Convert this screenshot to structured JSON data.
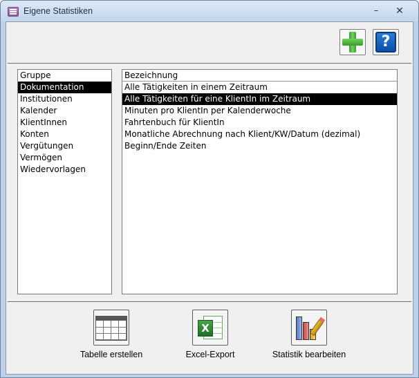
{
  "window": {
    "title": "Eigene Statistiken",
    "minimize_glyph": "–",
    "close_glyph": "✕"
  },
  "toolbar": {
    "add_icon": "plus-icon",
    "help_icon": "help-icon",
    "help_glyph": "?"
  },
  "group_list": {
    "header": "Gruppe",
    "selected_index": 0,
    "items": [
      "Dokumentation",
      "Institutionen",
      "Kalender",
      "KlientInnen",
      "Konten",
      "Vergütungen",
      "Vermögen",
      "Wiedervorlagen"
    ]
  },
  "stat_list": {
    "header": "Bezeichnung",
    "selected_index": 1,
    "items": [
      "Alle Tätigkeiten in einem Zeitraum",
      "Alle Tätigkeiten für eine KlientIn im Zeitraum",
      "Minuten pro KlientIn per Kalenderwoche",
      "Fahrtenbuch für KlientIn",
      "Monatliche Abrechnung nach Klient/KW/Datum (dezimal)",
      "Beginn/Ende Zeiten"
    ]
  },
  "actions": {
    "table_label": "Tabelle erstellen",
    "excel_label": "Excel-Export",
    "excel_glyph": "X",
    "chart_label": "Statistik bearbeiten"
  },
  "colors": {
    "selection": "#000000",
    "frame": "#bcd0e8"
  }
}
